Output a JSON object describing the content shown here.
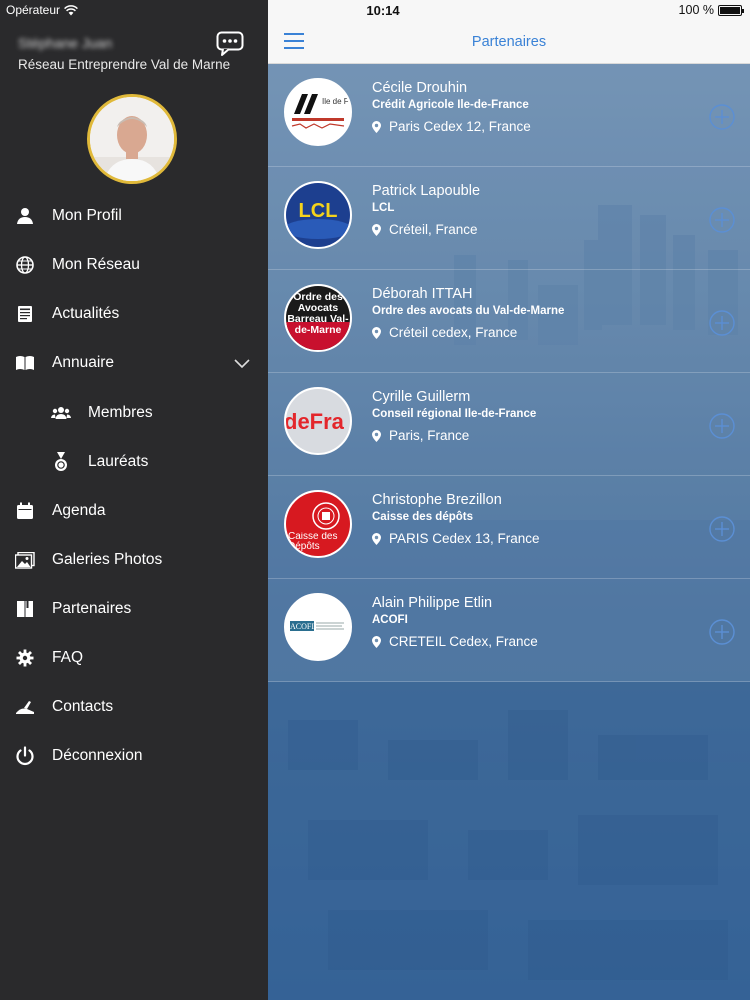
{
  "status": {
    "carrier": "Opérateur",
    "time": "10:14",
    "battery": "100 %"
  },
  "sidebar": {
    "user_name": "Stéphane Juan",
    "organization": "Réseau Entreprendre Val de Marne",
    "menu": [
      {
        "label": "Mon Profil",
        "icon": "person-icon"
      },
      {
        "label": "Mon Réseau",
        "icon": "globe-icon"
      },
      {
        "label": "Actualités",
        "icon": "newspaper-icon"
      },
      {
        "label": "Annuaire",
        "icon": "book-icon"
      },
      {
        "label": "Membres",
        "icon": "group-icon"
      },
      {
        "label": "Lauréats",
        "icon": "medal-icon"
      },
      {
        "label": "Agenda",
        "icon": "calendar-icon"
      },
      {
        "label": "Galeries Photos",
        "icon": "photos-icon"
      },
      {
        "label": "Partenaires",
        "icon": "partners-book-icon"
      },
      {
        "label": "FAQ",
        "icon": "gear-icon"
      },
      {
        "label": "Contacts",
        "icon": "contacts-icon"
      },
      {
        "label": "Déconnexion",
        "icon": "power-icon"
      }
    ]
  },
  "header": {
    "title": "Partenaires"
  },
  "partners": [
    {
      "name": "Cécile Drouhin",
      "organization": "Crédit Agricole Ile-de-France",
      "location": "Paris Cedex 12, France",
      "logo_text": "Ile de France"
    },
    {
      "name": "Patrick Lapouble",
      "organization": "LCL",
      "location": "Créteil, France",
      "logo_text": "LCL"
    },
    {
      "name": "Déborah ITTAH",
      "organization": "Ordre des avocats du Val-de-Marne",
      "location": "Créteil cedex, France",
      "logo_text": "Ordre des Avocats Barreau Val-de-Marne"
    },
    {
      "name": "Cyrille Guillerm",
      "organization": "Conseil régional Ile-de-France",
      "location": "Paris, France",
      "logo_text": "deFra"
    },
    {
      "name": "Christophe Brezillon",
      "organization": "Caisse des dépôts",
      "location": "PARIS Cedex 13, France",
      "logo_text": "Caisse des Dépôts"
    },
    {
      "name": "Alain Philippe Etlin",
      "organization": "ACOFI",
      "location": "CRETEIL Cedex, France",
      "logo_text": "ACOFI"
    }
  ],
  "colors": {
    "accent": "#3a82d6",
    "sidebar_bg": "#2a2a2c",
    "avatar_ring": "#e0b93a"
  }
}
